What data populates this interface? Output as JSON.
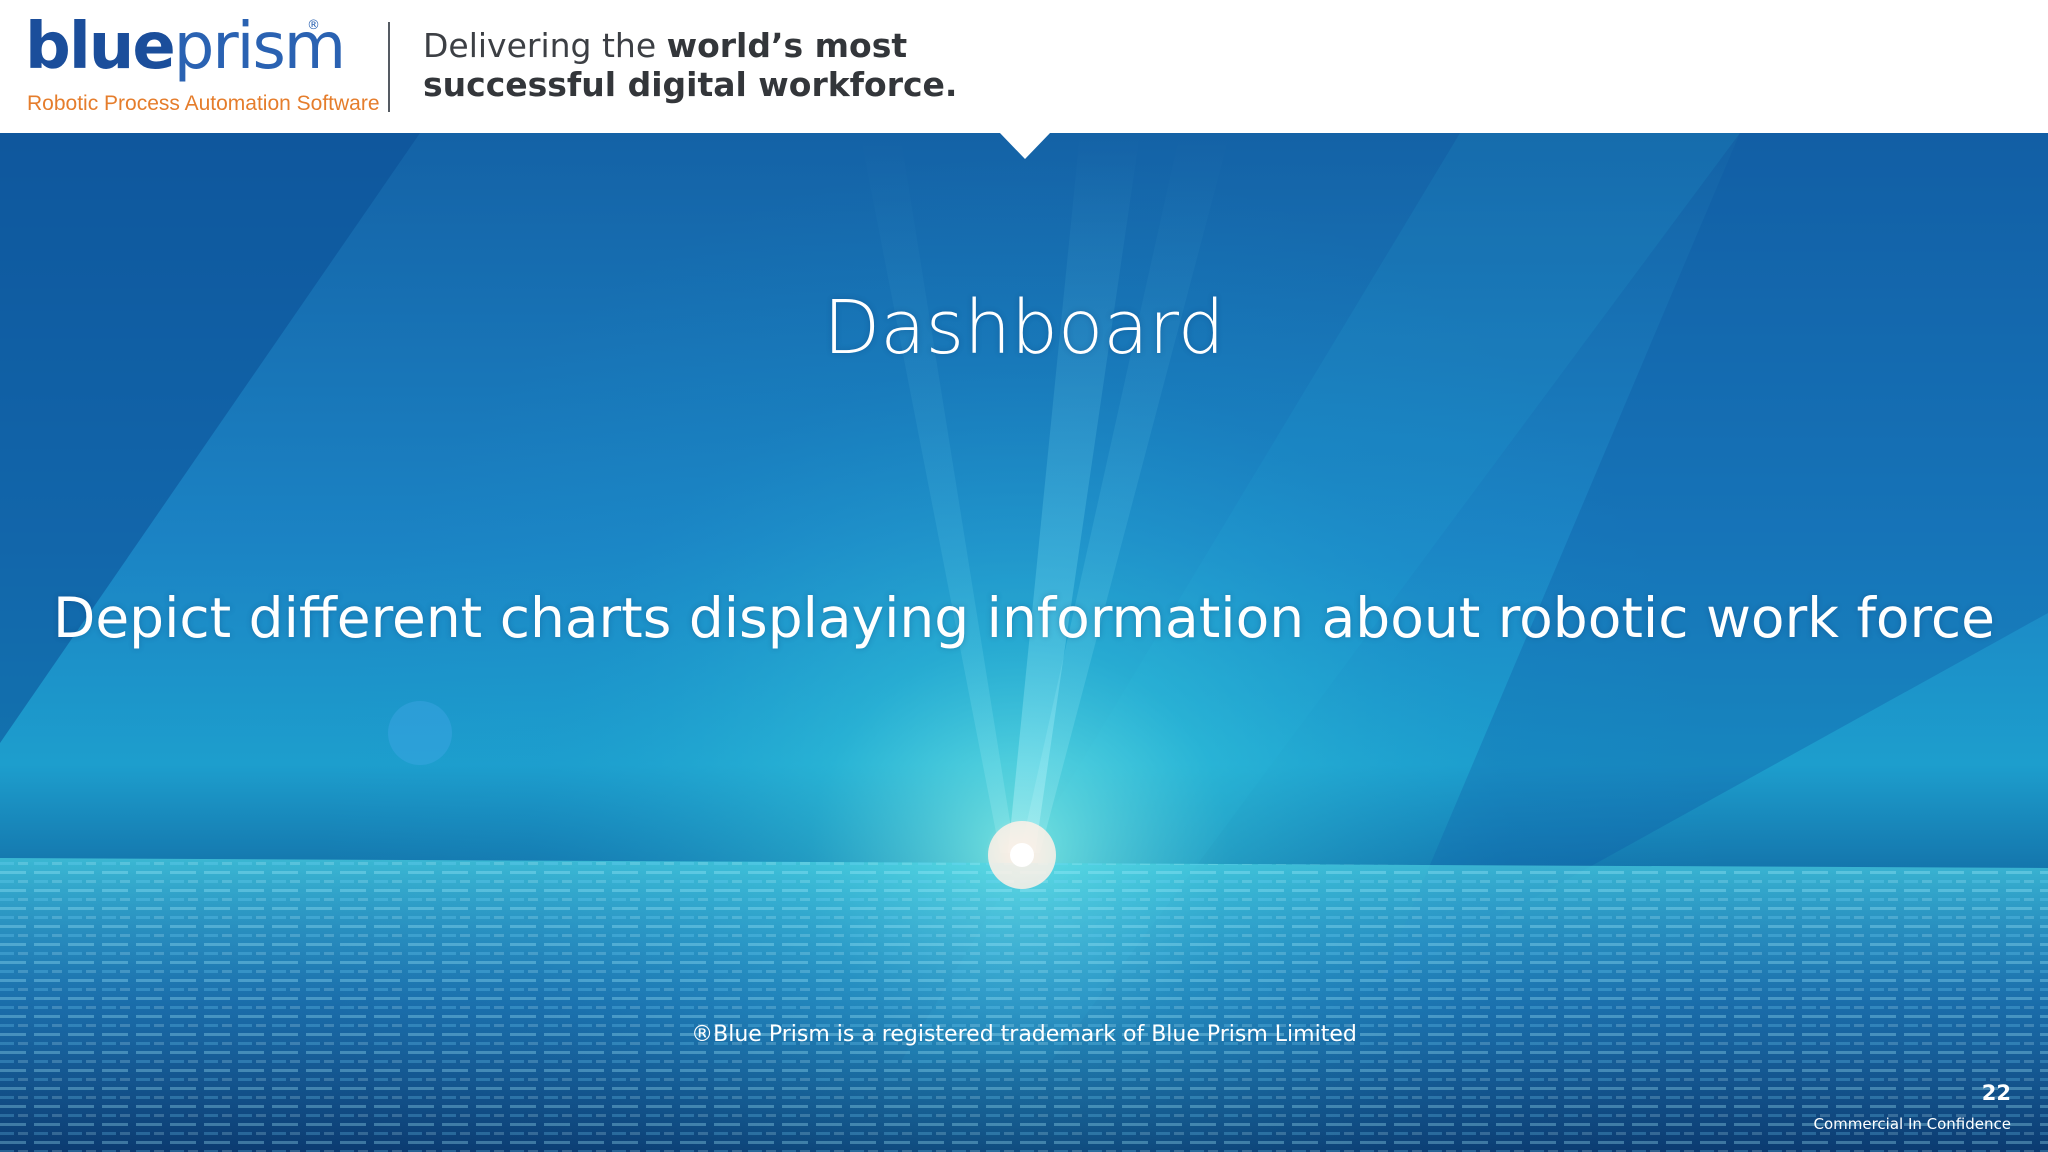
{
  "header": {
    "logo": {
      "word_blue": "blue",
      "word_prism": "prism",
      "registered_mark": "®",
      "tagline": "Robotic Process Automation Software"
    },
    "slogan": {
      "line1_regular": "Delivering the ",
      "line1_bold": "world’s most",
      "line2_bold": "successful digital workforce."
    }
  },
  "slide": {
    "title": "Dashboard",
    "subtitle": "Depict different charts displaying information about robotic work force",
    "trademark": "®Blue Prism is a registered trademark of Blue Prism Limited",
    "page_number": "22",
    "footer_label": "Commercial In Confidence"
  },
  "colors": {
    "logo_blue": "#1b4e9b",
    "tagline_orange": "#e57d2c",
    "slogan_gray": "#3c3f44",
    "background_blue": "#1b83c4"
  }
}
